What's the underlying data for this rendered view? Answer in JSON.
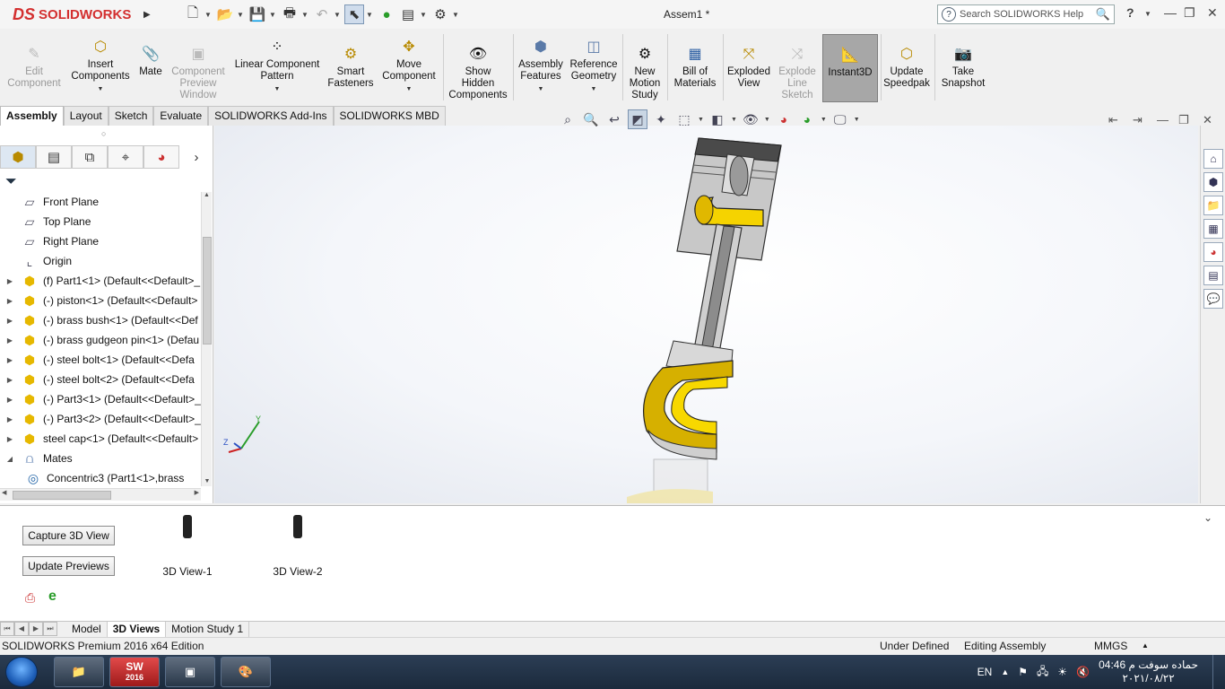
{
  "app": {
    "logo_prefix": "DS",
    "logo_text": "SOLIDWORKS",
    "document_title": "Assem1 *",
    "search_placeholder": "Search SOLIDWORKS Help",
    "help_label": "?"
  },
  "ribbon": [
    {
      "key": "edit_component",
      "label": "Edit\nComponent",
      "enabled": false
    },
    {
      "key": "insert_components",
      "label": "Insert\nComponents",
      "enabled": true
    },
    {
      "key": "mate",
      "label": "Mate",
      "enabled": true
    },
    {
      "key": "component_preview",
      "label": "Component\nPreview\nWindow",
      "enabled": false
    },
    {
      "key": "linear_pattern",
      "label": "Linear Component\nPattern",
      "enabled": true
    },
    {
      "key": "smart_fasteners",
      "label": "Smart\nFasteners",
      "enabled": true
    },
    {
      "key": "move_component",
      "label": "Move\nComponent",
      "enabled": true
    },
    {
      "key": "show_hidden",
      "label": "Show\nHidden\nComponents",
      "enabled": true
    },
    {
      "key": "assembly_features",
      "label": "Assembly\nFeatures",
      "enabled": true
    },
    {
      "key": "reference_geometry",
      "label": "Reference\nGeometry",
      "enabled": true
    },
    {
      "key": "new_motion_study",
      "label": "New\nMotion\nStudy",
      "enabled": true
    },
    {
      "key": "bill_of_materials",
      "label": "Bill of\nMaterials",
      "enabled": true
    },
    {
      "key": "exploded_view",
      "label": "Exploded\nView",
      "enabled": true
    },
    {
      "key": "explode_line_sketch",
      "label": "Explode\nLine\nSketch",
      "enabled": false
    },
    {
      "key": "instant3d",
      "label": "Instant3D",
      "enabled": true,
      "active": true
    },
    {
      "key": "update_speedpak",
      "label": "Update\nSpeedpak",
      "enabled": true
    },
    {
      "key": "take_snapshot",
      "label": "Take\nSnapshot",
      "enabled": true
    }
  ],
  "command_tabs": [
    "Assembly",
    "Layout",
    "Sketch",
    "Evaluate",
    "SOLIDWORKS Add-Ins",
    "SOLIDWORKS MBD"
  ],
  "active_command_tab": "Assembly",
  "feature_tree": [
    {
      "label": "Front Plane",
      "icon": "plane-icon",
      "expandable": false
    },
    {
      "label": "Top Plane",
      "icon": "plane-icon",
      "expandable": false
    },
    {
      "label": "Right Plane",
      "icon": "plane-icon",
      "expandable": false
    },
    {
      "label": "Origin",
      "icon": "origin-icon",
      "expandable": false
    },
    {
      "label": "(f) Part1<1> (Default<<Default>_",
      "icon": "part-icon",
      "expandable": true
    },
    {
      "label": "(-) piston<1> (Default<<Default>",
      "icon": "part-icon",
      "expandable": true
    },
    {
      "label": "(-) brass bush<1> (Default<<Def",
      "icon": "part-icon",
      "expandable": true
    },
    {
      "label": "(-) brass gudgeon pin<1> (Defau",
      "icon": "part-icon",
      "expandable": true
    },
    {
      "label": "(-) steel bolt<1> (Default<<Defa",
      "icon": "part-icon",
      "expandable": true
    },
    {
      "label": "(-) steel bolt<2> (Default<<Defa",
      "icon": "part-icon",
      "expandable": true
    },
    {
      "label": "(-) Part3<1> (Default<<Default>_",
      "icon": "part-icon",
      "expandable": true
    },
    {
      "label": "(-) Part3<2> (Default<<Default>_",
      "icon": "part-icon",
      "expandable": true
    },
    {
      "label": "steel cap<1> (Default<<Default>",
      "icon": "part-icon",
      "expandable": true
    },
    {
      "label": "Mates",
      "icon": "mates-icon",
      "expandable": true,
      "expanded": true
    },
    {
      "label": "Concentric3 (Part1<1>,brass",
      "icon": "concentric-icon",
      "expandable": false,
      "indent": true
    }
  ],
  "bottom_panel": {
    "capture_button": "Capture 3D View",
    "update_button": "Update Previews",
    "views": [
      "3D View-1",
      "3D View-2"
    ]
  },
  "bottom_tabs": [
    "Model",
    "3D Views",
    "Motion Study 1"
  ],
  "active_bottom_tab": "3D Views",
  "status_bar": {
    "edition": "SOLIDWORKS Premium 2016 x64 Edition",
    "state": "Under Defined",
    "mode": "Editing Assembly",
    "units": "MMGS"
  },
  "taskbar": {
    "sw_app_label": "2016",
    "language": "EN",
    "time": "04:46 حماده سوفت م",
    "date": "٢٠٢١/٠٨/٢٢"
  },
  "colors": {
    "brand": "#d32f2f",
    "part_gold": "#e6b800",
    "viewport_bg": "#eef1f6"
  }
}
